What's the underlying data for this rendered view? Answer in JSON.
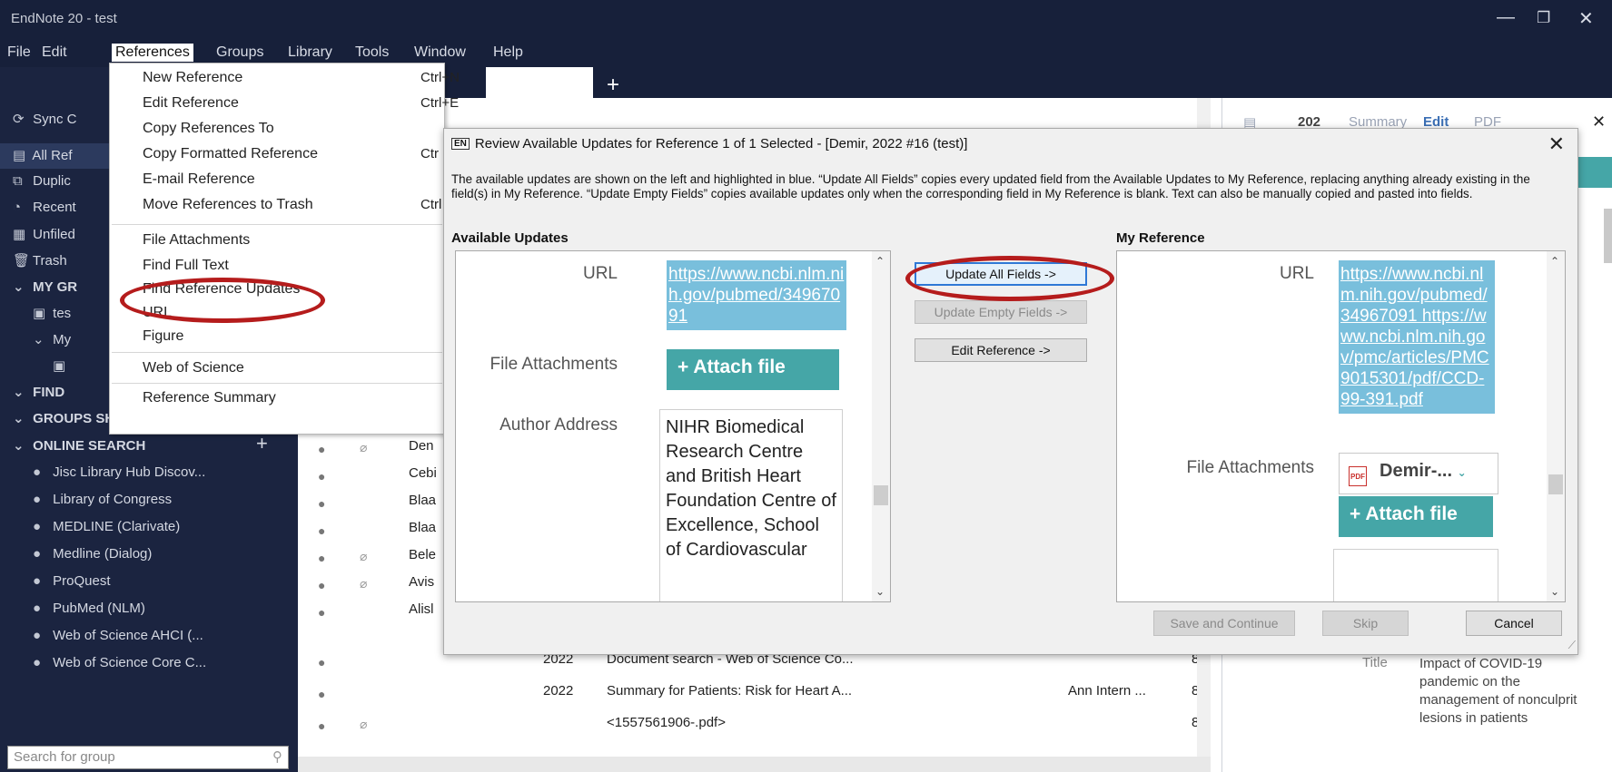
{
  "window": {
    "title": "EndNote 20 - test",
    "minimize": "—",
    "restore": "❐",
    "close": "✕"
  },
  "menubar": [
    "File",
    "Edit",
    "References",
    "Groups",
    "Library",
    "Tools",
    "Window",
    "Help"
  ],
  "tabs": {
    "add": "+"
  },
  "sidebar": {
    "sync": "Sync C",
    "items": [
      {
        "label": "All Ref",
        "icon": "▤"
      },
      {
        "label": "Duplic",
        "icon": "⧉"
      },
      {
        "label": "Recent",
        "icon": "◔"
      },
      {
        "label": "Unfiled",
        "icon": "▦"
      },
      {
        "label": "Trash",
        "icon": "🗑"
      }
    ],
    "my_groups": "MY GR",
    "group_test": "tes",
    "my_sub": "My",
    "find": "FIND",
    "groups_shared": "GROUPS SHARED BY O...",
    "online_search": "ONLINE SEARCH",
    "online_add": "+",
    "online_items": [
      "Jisc Library Hub Discov...",
      "Library of Congress",
      "MEDLINE (Clarivate)",
      "Medline (Dialog)",
      "ProQuest",
      "PubMed (NLM)",
      "Web of Science AHCI (...",
      "Web of Science Core C..."
    ],
    "search_placeholder": "Search for group"
  },
  "references_menu": {
    "items": [
      {
        "label": "New Reference",
        "shortcut": "Ctrl+N"
      },
      {
        "label": "Edit Reference",
        "shortcut": "Ctrl+E"
      },
      {
        "label": "Copy References To",
        "shortcut": ""
      },
      {
        "label": "Copy Formatted Reference",
        "shortcut": "Ctr"
      },
      {
        "label": "E-mail Reference",
        "shortcut": ""
      },
      {
        "label": "Move References to Trash",
        "shortcut": "Ctrl"
      },
      {
        "label": "File Attachments",
        "shortcut": ""
      },
      {
        "label": "Find Full Text",
        "shortcut": ""
      },
      {
        "label": "Find Reference Updates",
        "shortcut": ""
      },
      {
        "label": "URL",
        "shortcut": ""
      },
      {
        "label": "Figure",
        "shortcut": ""
      },
      {
        "label": "Web of Science",
        "shortcut": ""
      },
      {
        "label": "Reference Summary",
        "shortcut": ""
      }
    ]
  },
  "reference_list": {
    "rows": [
      {
        "author": "Den",
        "year": "",
        "title": "",
        "journal": "",
        "num": "",
        "clip": true
      },
      {
        "author": "Cebi",
        "year": "",
        "title": "",
        "journal": "",
        "num": "",
        "clip": false
      },
      {
        "author": "Blaa",
        "year": "",
        "title": "",
        "journal": "",
        "num": "",
        "clip": false
      },
      {
        "author": "Blaa",
        "year": "",
        "title": "",
        "journal": "",
        "num": "",
        "clip": false
      },
      {
        "author": "Bele",
        "year": "",
        "title": "",
        "journal": "",
        "num": "",
        "clip": true
      },
      {
        "author": "Avis",
        "year": "",
        "title": "",
        "journal": "",
        "num": "",
        "clip": true
      },
      {
        "author": "Alisl",
        "year": "",
        "title": "",
        "journal": "",
        "num": "",
        "clip": false
      },
      {
        "author": "",
        "year": "2022",
        "title": "Document search - Web of Science Co...",
        "journal": "",
        "num": "8",
        "clip": false
      },
      {
        "author": "",
        "year": "2022",
        "title": "Summary for Patients: Risk for Heart A...",
        "journal": "Ann Intern ...",
        "num": "8",
        "clip": false
      },
      {
        "author": "",
        "year": "",
        "title": "<1557561906-.pdf>",
        "journal": "",
        "num": "8",
        "clip": true
      }
    ]
  },
  "right_panel": {
    "ref_num": "202",
    "tabs": [
      "Summary",
      "Edit",
      "PDF"
    ],
    "title_label": "Title",
    "title_value": "Impact of COVID-19 pandemic on the management of nonculprit lesions in patients"
  },
  "dialog": {
    "en_badge": "EN",
    "title": "Review Available Updates for Reference 1 of 1 Selected - [Demir, 2022 #16 (test)]",
    "close": "✕",
    "description": "The available updates are shown on the left and highlighted in blue. “Update All Fields” copies every updated field from the Available Updates to My Reference, replacing anything already existing in the field(s) in My Reference. “Update Empty Fields” copies available updates only when the corresponding field in My Reference is blank. Text can also be manually copied and pasted into fields.",
    "available_header": "Available Updates",
    "my_header": "My Reference",
    "available": {
      "url_label": "URL",
      "url": "https://www.ncbi.nlm.nih.gov/pubmed/34967091",
      "file_label": "File Attachments",
      "attach_label": "+  Attach file",
      "address_label": "Author Address",
      "address": "NIHR Biomedical Research Centre and British Heart Foundation Centre of Excellence, School of Cardiovascular"
    },
    "mine": {
      "url_label": "URL",
      "url": "https://www.ncbi.nlm.nih.gov/pubmed/34967091 https://www.ncbi.nlm.nih.gov/pmc/articles/PMC9015301/pdf/CCD-99-391.pdf",
      "file_label": "File Attachments",
      "file_name": "Demir-...",
      "attach_label": "+  Attach file"
    },
    "buttons": {
      "update_all": "Update All Fields ->",
      "update_empty": "Update Empty Fields ->",
      "edit_reference": "Edit Reference ->",
      "save_continue": "Save and Continue",
      "skip": "Skip",
      "cancel": "Cancel"
    }
  },
  "colors": {
    "dark": "#17203a",
    "teal": "#45a6a7",
    "url_bg": "#79bfdc",
    "annotation": "#b51c1c"
  }
}
